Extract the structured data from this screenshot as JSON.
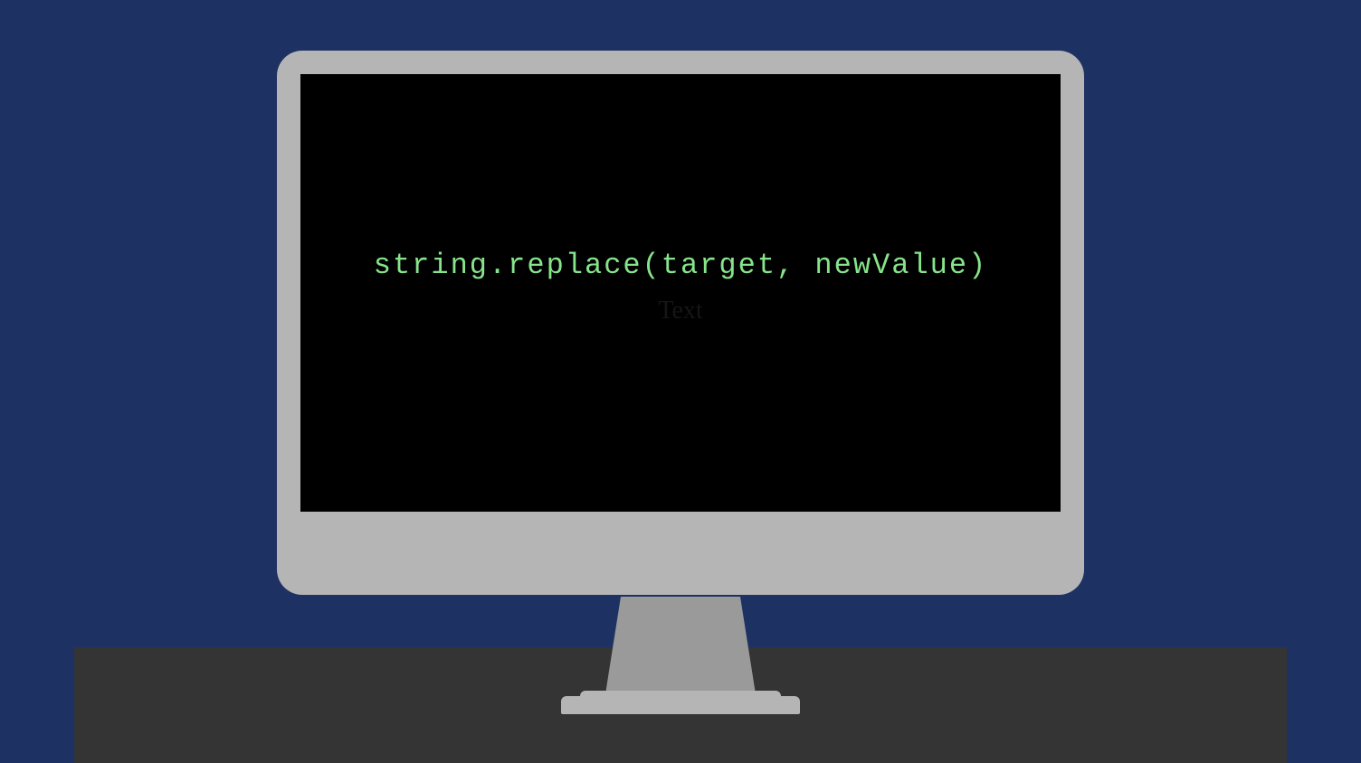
{
  "screen": {
    "code_line": "string.replace(target, newValue)",
    "ghost_label": "Text"
  },
  "colors": {
    "background": "#1e3163",
    "desk": "#343434",
    "monitor_body": "#b5b5b5",
    "monitor_stand": "#9a9a9a",
    "screen": "#000000",
    "code_text": "#86e48a"
  }
}
